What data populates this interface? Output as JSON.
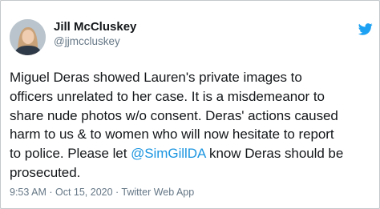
{
  "author": {
    "name": "Jill McCluskey",
    "handle": "@jjmccluskey"
  },
  "icons": {
    "brand": "twitter-bird-icon",
    "brand_color": "#1da1f2"
  },
  "tweet": {
    "lines": [
      "Miguel Deras showed Lauren's private images to",
      "officers unrelated to her case. It is a misdemeanor to",
      "share nude photos w/o consent. Deras' actions caused",
      "harm to us & to women who will now hesitate to report"
    ],
    "line5_before": "to police. Please let",
    "mention": "@SimGillDA",
    "line5_after": "know Deras should be",
    "line6": "prosecuted.",
    "mention_color": "#1b95e0"
  },
  "meta": {
    "timestamp": "9:53 AM · Oct 15, 2020 · Twitter Web App"
  }
}
